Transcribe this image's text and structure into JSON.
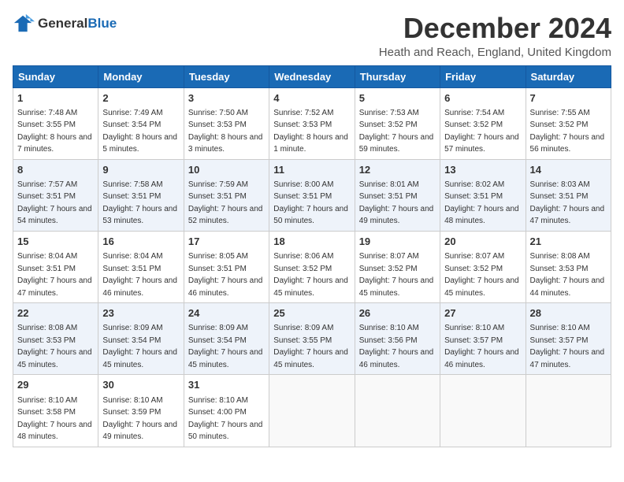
{
  "logo": {
    "general": "General",
    "blue": "Blue"
  },
  "title": "December 2024",
  "location": "Heath and Reach, England, United Kingdom",
  "headers": [
    "Sunday",
    "Monday",
    "Tuesday",
    "Wednesday",
    "Thursday",
    "Friday",
    "Saturday"
  ],
  "weeks": [
    [
      {
        "day": "1",
        "sunrise": "7:48 AM",
        "sunset": "3:55 PM",
        "daylight": "8 hours and 7 minutes."
      },
      {
        "day": "2",
        "sunrise": "7:49 AM",
        "sunset": "3:54 PM",
        "daylight": "8 hours and 5 minutes."
      },
      {
        "day": "3",
        "sunrise": "7:50 AM",
        "sunset": "3:53 PM",
        "daylight": "8 hours and 3 minutes."
      },
      {
        "day": "4",
        "sunrise": "7:52 AM",
        "sunset": "3:53 PM",
        "daylight": "8 hours and 1 minute."
      },
      {
        "day": "5",
        "sunrise": "7:53 AM",
        "sunset": "3:52 PM",
        "daylight": "7 hours and 59 minutes."
      },
      {
        "day": "6",
        "sunrise": "7:54 AM",
        "sunset": "3:52 PM",
        "daylight": "7 hours and 57 minutes."
      },
      {
        "day": "7",
        "sunrise": "7:55 AM",
        "sunset": "3:52 PM",
        "daylight": "7 hours and 56 minutes."
      }
    ],
    [
      {
        "day": "8",
        "sunrise": "7:57 AM",
        "sunset": "3:51 PM",
        "daylight": "7 hours and 54 minutes."
      },
      {
        "day": "9",
        "sunrise": "7:58 AM",
        "sunset": "3:51 PM",
        "daylight": "7 hours and 53 minutes."
      },
      {
        "day": "10",
        "sunrise": "7:59 AM",
        "sunset": "3:51 PM",
        "daylight": "7 hours and 52 minutes."
      },
      {
        "day": "11",
        "sunrise": "8:00 AM",
        "sunset": "3:51 PM",
        "daylight": "7 hours and 50 minutes."
      },
      {
        "day": "12",
        "sunrise": "8:01 AM",
        "sunset": "3:51 PM",
        "daylight": "7 hours and 49 minutes."
      },
      {
        "day": "13",
        "sunrise": "8:02 AM",
        "sunset": "3:51 PM",
        "daylight": "7 hours and 48 minutes."
      },
      {
        "day": "14",
        "sunrise": "8:03 AM",
        "sunset": "3:51 PM",
        "daylight": "7 hours and 47 minutes."
      }
    ],
    [
      {
        "day": "15",
        "sunrise": "8:04 AM",
        "sunset": "3:51 PM",
        "daylight": "7 hours and 47 minutes."
      },
      {
        "day": "16",
        "sunrise": "8:04 AM",
        "sunset": "3:51 PM",
        "daylight": "7 hours and 46 minutes."
      },
      {
        "day": "17",
        "sunrise": "8:05 AM",
        "sunset": "3:51 PM",
        "daylight": "7 hours and 46 minutes."
      },
      {
        "day": "18",
        "sunrise": "8:06 AM",
        "sunset": "3:52 PM",
        "daylight": "7 hours and 45 minutes."
      },
      {
        "day": "19",
        "sunrise": "8:07 AM",
        "sunset": "3:52 PM",
        "daylight": "7 hours and 45 minutes."
      },
      {
        "day": "20",
        "sunrise": "8:07 AM",
        "sunset": "3:52 PM",
        "daylight": "7 hours and 45 minutes."
      },
      {
        "day": "21",
        "sunrise": "8:08 AM",
        "sunset": "3:53 PM",
        "daylight": "7 hours and 44 minutes."
      }
    ],
    [
      {
        "day": "22",
        "sunrise": "8:08 AM",
        "sunset": "3:53 PM",
        "daylight": "7 hours and 45 minutes."
      },
      {
        "day": "23",
        "sunrise": "8:09 AM",
        "sunset": "3:54 PM",
        "daylight": "7 hours and 45 minutes."
      },
      {
        "day": "24",
        "sunrise": "8:09 AM",
        "sunset": "3:54 PM",
        "daylight": "7 hours and 45 minutes."
      },
      {
        "day": "25",
        "sunrise": "8:09 AM",
        "sunset": "3:55 PM",
        "daylight": "7 hours and 45 minutes."
      },
      {
        "day": "26",
        "sunrise": "8:10 AM",
        "sunset": "3:56 PM",
        "daylight": "7 hours and 46 minutes."
      },
      {
        "day": "27",
        "sunrise": "8:10 AM",
        "sunset": "3:57 PM",
        "daylight": "7 hours and 46 minutes."
      },
      {
        "day": "28",
        "sunrise": "8:10 AM",
        "sunset": "3:57 PM",
        "daylight": "7 hours and 47 minutes."
      }
    ],
    [
      {
        "day": "29",
        "sunrise": "8:10 AM",
        "sunset": "3:58 PM",
        "daylight": "7 hours and 48 minutes."
      },
      {
        "day": "30",
        "sunrise": "8:10 AM",
        "sunset": "3:59 PM",
        "daylight": "7 hours and 49 minutes."
      },
      {
        "day": "31",
        "sunrise": "8:10 AM",
        "sunset": "4:00 PM",
        "daylight": "7 hours and 50 minutes."
      },
      null,
      null,
      null,
      null
    ]
  ]
}
